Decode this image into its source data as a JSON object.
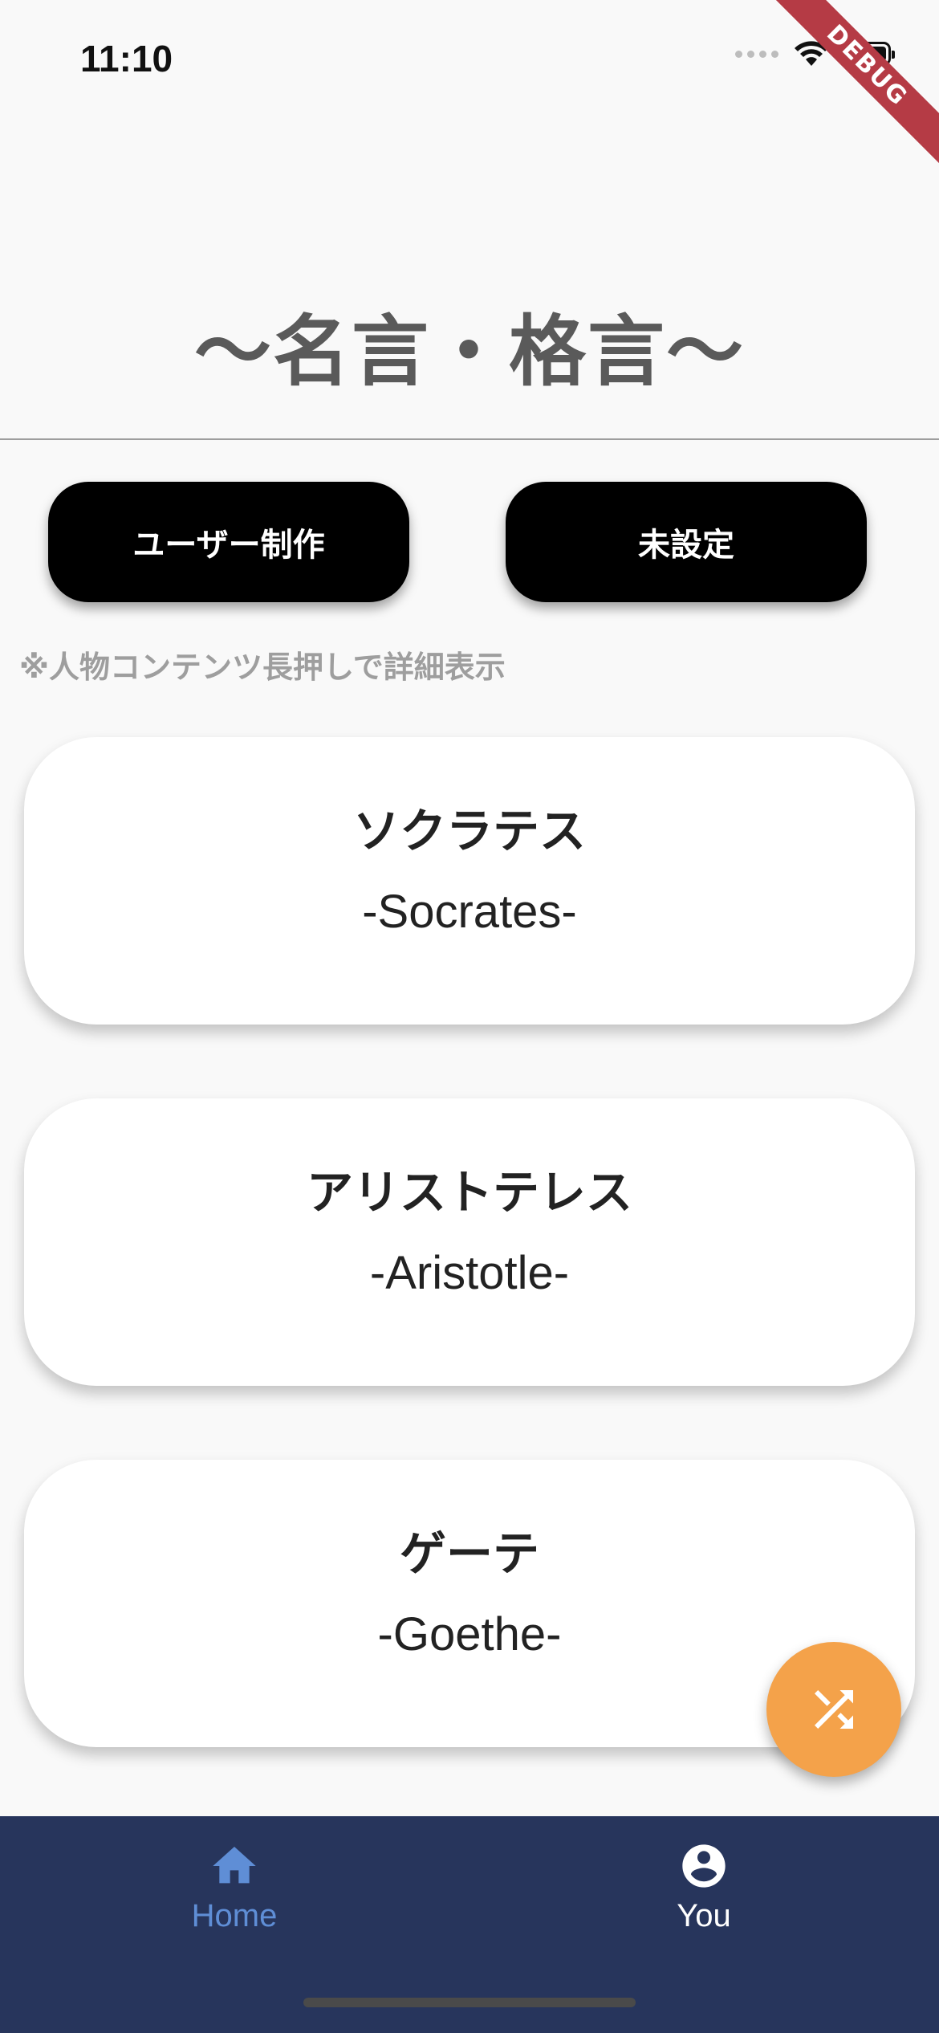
{
  "status_bar": {
    "time": "11:10",
    "icons": [
      "signal-icon",
      "wifi-icon",
      "battery-icon"
    ]
  },
  "debug_banner": "DEBUG",
  "title": "〜名言・格言〜",
  "filters": {
    "left_label": "ユーザー制作",
    "right_label": "未設定"
  },
  "hint": "※人物コンテンツ長押しで詳細表示",
  "people": [
    {
      "name": "ソクラテス",
      "english": "-Socrates-"
    },
    {
      "name": "アリストテレス",
      "english": "-Aristotle-"
    },
    {
      "name": "ゲーテ",
      "english": "-Goethe-"
    }
  ],
  "fab": {
    "icon": "shuffle-icon",
    "color": "#f4a24a"
  },
  "bottom_nav": {
    "items": [
      {
        "label": "Home",
        "icon": "home-icon",
        "active": true
      },
      {
        "label": "You",
        "icon": "account-circle-icon",
        "active": false
      }
    ],
    "background": "#27355c",
    "active_color": "#5f8ed6"
  }
}
